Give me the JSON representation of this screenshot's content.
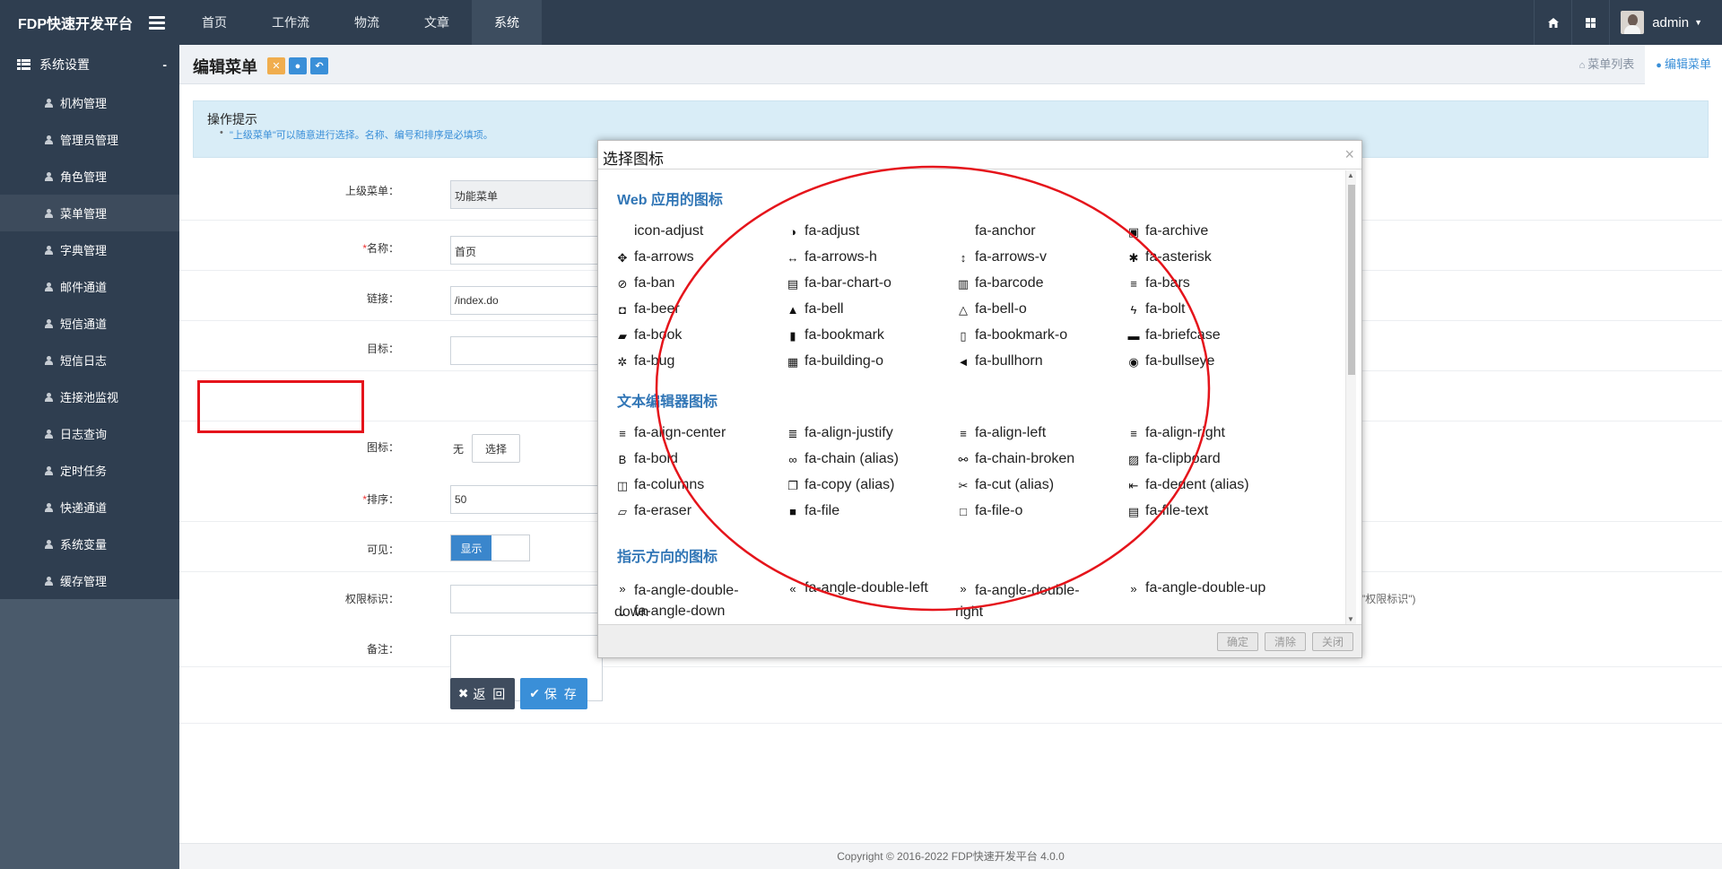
{
  "navbar": {
    "brand": "FDP快速开发平台",
    "menu": [
      {
        "label": "首页",
        "active": false
      },
      {
        "label": "工作流",
        "active": false
      },
      {
        "label": "物流",
        "active": false
      },
      {
        "label": "文章",
        "active": false
      },
      {
        "label": "系统",
        "active": true
      }
    ],
    "user": "admin"
  },
  "sidebar": {
    "header": "系统设置",
    "collapse_symbol": "-",
    "items": [
      {
        "label": "机构管理",
        "active": false
      },
      {
        "label": "管理员管理",
        "active": false
      },
      {
        "label": "角色管理",
        "active": false
      },
      {
        "label": "菜单管理",
        "active": true
      },
      {
        "label": "字典管理",
        "active": false
      },
      {
        "label": "邮件通道",
        "active": false
      },
      {
        "label": "短信通道",
        "active": false
      },
      {
        "label": "短信日志",
        "active": false
      },
      {
        "label": "连接池监视",
        "active": false
      },
      {
        "label": "日志查询",
        "active": false
      },
      {
        "label": "定时任务",
        "active": false
      },
      {
        "label": "快递通道",
        "active": false
      },
      {
        "label": "系统变量",
        "active": false
      },
      {
        "label": "缓存管理",
        "active": false
      }
    ]
  },
  "page": {
    "title": "编辑菜单",
    "tabs": [
      {
        "label": "菜单列表",
        "active": false
      },
      {
        "label": "编辑菜单",
        "active": true
      }
    ],
    "tip_title": "操作提示",
    "tip_text": "\"上级菜单\"可以随意进行选择。名称、编号和排序是必填项。"
  },
  "form": {
    "parent_label": "上级菜单：",
    "parent_value": "功能菜单",
    "name_label": "名称：",
    "name_value": "首页",
    "link_label": "链接：",
    "link_value": "/index.do",
    "target_label": "目标：",
    "target_value": "",
    "icon_label": "图标：",
    "icon_value": "无",
    "icon_button": "选择",
    "sort_label": "排序：",
    "sort_value": "50",
    "visible_label": "可见：",
    "visible_value": "显示",
    "perm_label": "权限标识：",
    "perm_value": "",
    "perm_hint": "\"权限标识\")",
    "remark_label": "备注：",
    "remark_value": "",
    "back_button": "返 回",
    "save_button": "保 存"
  },
  "modal": {
    "title": "选择图标",
    "close": "×",
    "sections": [
      {
        "title": "Web 应用的图标",
        "icons": [
          {
            "glyph": "",
            "name": "icon-adjust"
          },
          {
            "glyph": "◑",
            "name": "fa-adjust"
          },
          {
            "glyph": "",
            "name": "fa-anchor"
          },
          {
            "glyph": "▣",
            "name": "fa-archive"
          },
          {
            "glyph": "✥",
            "name": "fa-arrows"
          },
          {
            "glyph": "↔",
            "name": "fa-arrows-h"
          },
          {
            "glyph": "↕",
            "name": "fa-arrows-v"
          },
          {
            "glyph": "✱",
            "name": "fa-asterisk"
          },
          {
            "glyph": "⊘",
            "name": "fa-ban"
          },
          {
            "glyph": "▤",
            "name": "fa-bar-chart-o"
          },
          {
            "glyph": "▥",
            "name": "fa-barcode"
          },
          {
            "glyph": "≡",
            "name": "fa-bars"
          },
          {
            "glyph": "◘",
            "name": "fa-beer"
          },
          {
            "glyph": "▲",
            "name": "fa-bell"
          },
          {
            "glyph": "△",
            "name": "fa-bell-o"
          },
          {
            "glyph": "ϟ",
            "name": "fa-bolt"
          },
          {
            "glyph": "▰",
            "name": "fa-book"
          },
          {
            "glyph": "▮",
            "name": "fa-bookmark"
          },
          {
            "glyph": "▯",
            "name": "fa-bookmark-o"
          },
          {
            "glyph": "▬",
            "name": "fa-briefcase"
          },
          {
            "glyph": "✲",
            "name": "fa-bug"
          },
          {
            "glyph": "▦",
            "name": "fa-building-o"
          },
          {
            "glyph": "◄",
            "name": "fa-bullhorn"
          },
          {
            "glyph": "◉",
            "name": "fa-bullseye"
          }
        ]
      },
      {
        "title": "文本编辑器图标",
        "icons": [
          {
            "glyph": "≡",
            "name": "fa-align-center"
          },
          {
            "glyph": "≣",
            "name": "fa-align-justify"
          },
          {
            "glyph": "≡",
            "name": "fa-align-left"
          },
          {
            "glyph": "≡",
            "name": "fa-align-right"
          },
          {
            "glyph": "B",
            "name": "fa-bold"
          },
          {
            "glyph": "∞",
            "name": "fa-chain (alias)"
          },
          {
            "glyph": "⚯",
            "name": "fa-chain-broken"
          },
          {
            "glyph": "▨",
            "name": "fa-clipboard"
          },
          {
            "glyph": "◫",
            "name": "fa-columns"
          },
          {
            "glyph": "❐",
            "name": "fa-copy (alias)"
          },
          {
            "glyph": "✂",
            "name": "fa-cut (alias)"
          },
          {
            "glyph": "⇤",
            "name": "fa-dedent (alias)"
          },
          {
            "glyph": "▱",
            "name": "fa-eraser"
          },
          {
            "glyph": "■",
            "name": "fa-file"
          },
          {
            "glyph": "□",
            "name": "fa-file-o"
          },
          {
            "glyph": "▤",
            "name": "fa-file-text"
          }
        ]
      },
      {
        "title": "指示方向的图标",
        "icons": [
          {
            "glyph": "»",
            "name": "fa-angle-double-down"
          },
          {
            "glyph": "«",
            "name": "fa-angle-double-left"
          },
          {
            "glyph": "»",
            "name": "fa-angle-double-right"
          },
          {
            "glyph": "»",
            "name": "fa-angle-double-up"
          },
          {
            "glyph": "⌄",
            "name": "fa-angle-down"
          }
        ]
      }
    ],
    "buttons": {
      "ok": "确定",
      "clear": "清除",
      "close": "关闭"
    }
  },
  "footer": "Copyright © 2016-2022  FDP快速开发平台  4.0.0",
  "colors": {
    "navbar": "#2f3e50",
    "sidebar": "#4a5a6b",
    "accent": "#3a8fd8",
    "highlight": "#e5141b"
  }
}
